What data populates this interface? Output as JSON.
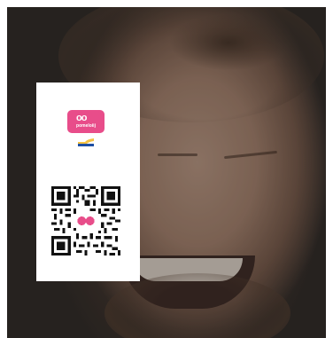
{
  "photo": {
    "subject": "smiling-man-photo"
  },
  "card": {
    "logo_text": "pomeloiij",
    "logo_eyes": "oo",
    "flag": "flag-icon",
    "qr": "qr-code"
  },
  "colors": {
    "brand_pink": "#e84d8a",
    "flag_yellow": "#f5c242",
    "flag_blue": "#1e4fa3"
  }
}
